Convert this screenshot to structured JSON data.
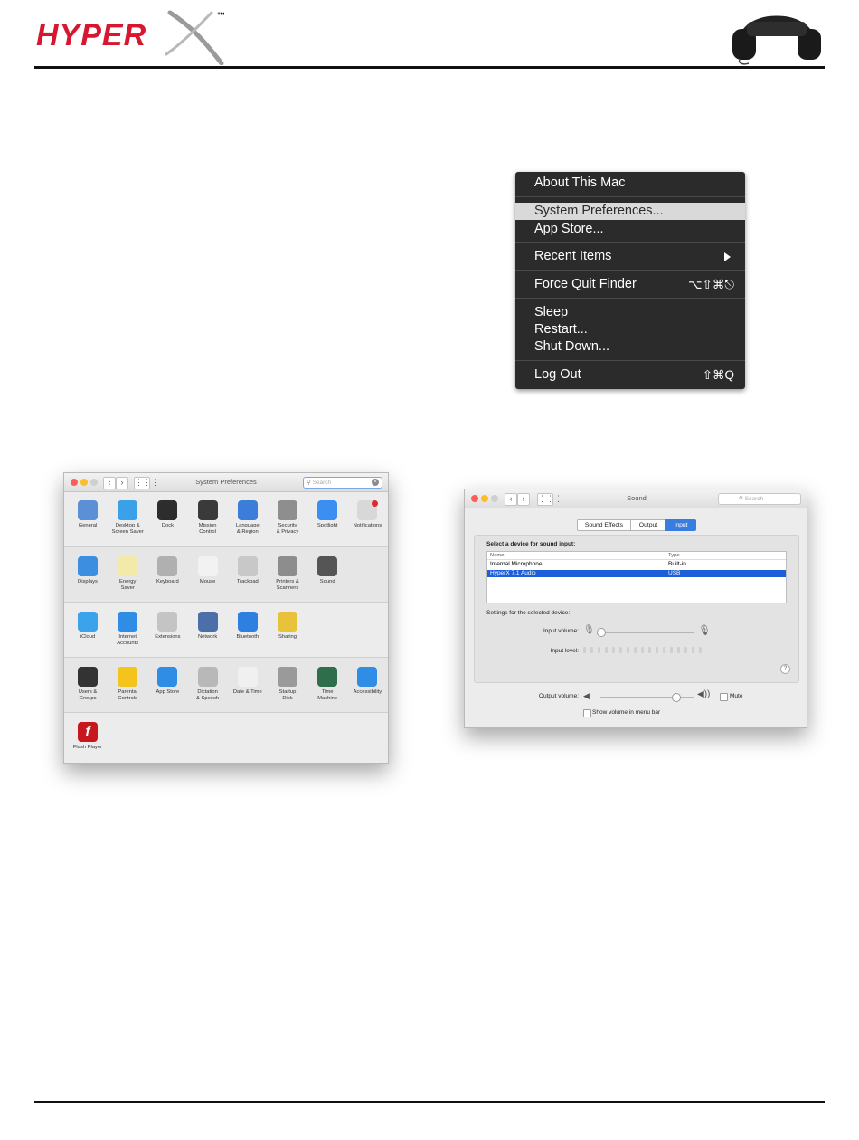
{
  "brand": {
    "logo_text": "HYPER",
    "trademark": "™",
    "accent": "#d7172f"
  },
  "apple_menu": {
    "items": [
      {
        "label": "About This Mac",
        "shortcut": ""
      },
      {
        "label": "System Preferences...",
        "shortcut": "",
        "highlighted": true
      },
      {
        "label": "App Store...",
        "shortcut": ""
      },
      {
        "label": "Recent Items",
        "shortcut": "",
        "submenu": true
      },
      {
        "label": "Force Quit Finder",
        "shortcut": "⌥⇧⌘⎋"
      },
      {
        "label": "Sleep",
        "shortcut": ""
      },
      {
        "label": "Restart...",
        "shortcut": ""
      },
      {
        "label": "Shut Down...",
        "shortcut": ""
      },
      {
        "label": "Log Out",
        "shortcut": "⇧⌘Q"
      }
    ]
  },
  "system_preferences": {
    "title": "System Preferences",
    "search_placeholder": "Search",
    "rows": [
      [
        {
          "label": "General",
          "icon": "general-icon",
          "color": "#5b8fd6"
        },
        {
          "label": "Desktop &\nScreen Saver",
          "icon": "desktop-icon",
          "color": "#3aa0e8"
        },
        {
          "label": "Dock",
          "icon": "dock-icon",
          "color": "#2d2d2d"
        },
        {
          "label": "Mission\nControl",
          "icon": "mission-control-icon",
          "color": "#3a3a3a"
        },
        {
          "label": "Language\n& Region",
          "icon": "globe-flag-icon",
          "color": "#3b7dd8"
        },
        {
          "label": "Security\n& Privacy",
          "icon": "house-lock-icon",
          "color": "#8e8e8e"
        },
        {
          "label": "Spotlight",
          "icon": "magnifier-icon",
          "color": "#3a8ff0"
        },
        {
          "label": "Notifications",
          "icon": "notifications-icon",
          "color": "#d8d8d8"
        }
      ],
      [
        {
          "label": "Displays",
          "icon": "display-icon",
          "color": "#3b8ee0"
        },
        {
          "label": "Energy\nSaver",
          "icon": "bulb-icon",
          "color": "#f3e9a8"
        },
        {
          "label": "Keyboard",
          "icon": "keyboard-icon",
          "color": "#b0b0b0"
        },
        {
          "label": "Mouse",
          "icon": "mouse-icon",
          "color": "#f2f2f2"
        },
        {
          "label": "Trackpad",
          "icon": "trackpad-icon",
          "color": "#c8c8c8"
        },
        {
          "label": "Printers &\nScanners",
          "icon": "printer-icon",
          "color": "#8d8d8d"
        },
        {
          "label": "Sound",
          "icon": "speaker-icon",
          "color": "#555555"
        }
      ],
      [
        {
          "label": "iCloud",
          "icon": "cloud-icon",
          "color": "#3aa3ea"
        },
        {
          "label": "Internet\nAccounts",
          "icon": "at-icon",
          "color": "#2f8de6"
        },
        {
          "label": "Extensions",
          "icon": "puzzle-icon",
          "color": "#c4c4c4"
        },
        {
          "label": "Network",
          "icon": "network-globe-icon",
          "color": "#4b6fa8"
        },
        {
          "label": "Bluetooth",
          "icon": "bluetooth-icon",
          "color": "#2f7fe0"
        },
        {
          "label": "Sharing",
          "icon": "sharing-icon",
          "color": "#e8c23a"
        }
      ],
      [
        {
          "label": "Users &\nGroups",
          "icon": "users-icon",
          "color": "#333333"
        },
        {
          "label": "Parental\nControls",
          "icon": "parental-icon",
          "color": "#f2c41c"
        },
        {
          "label": "App Store",
          "icon": "appstore-icon",
          "color": "#2f8de6"
        },
        {
          "label": "Dictation\n& Speech",
          "icon": "microphone-icon",
          "color": "#b8b8b8"
        },
        {
          "label": "Date & Time",
          "icon": "clock-icon",
          "color": "#f0f0f0"
        },
        {
          "label": "Startup\nDisk",
          "icon": "disk-icon",
          "color": "#9a9a9a"
        },
        {
          "label": "Time\nMachine",
          "icon": "time-machine-icon",
          "color": "#2f6e4a"
        },
        {
          "label": "Accessibility",
          "icon": "accessibility-icon",
          "color": "#2f8de6"
        }
      ],
      [
        {
          "label": "Flash Player",
          "icon": "flash-icon",
          "color": "#c8161d"
        }
      ]
    ]
  },
  "sound": {
    "title": "Sound",
    "search_placeholder": "Search",
    "tabs": [
      {
        "label": "Sound Effects",
        "active": false
      },
      {
        "label": "Output",
        "active": false
      },
      {
        "label": "Input",
        "active": true
      }
    ],
    "select_label": "Select a device for sound input:",
    "columns": [
      "Name",
      "Type"
    ],
    "devices": [
      {
        "name": "Internal Microphone",
        "type": "Built-in",
        "selected": false
      },
      {
        "name": "HyperX 7.1 Audio",
        "type": "USB",
        "selected": true
      }
    ],
    "settings_label": "Settings for the selected device:",
    "input_volume_label": "Input volume:",
    "input_volume": 0.0,
    "input_level_label": "Input level:",
    "help": "?",
    "output_volume_label": "Output volume:",
    "output_volume": 0.8,
    "mute_label": "Mute",
    "show_volume_label": "Show volume in menu bar"
  }
}
